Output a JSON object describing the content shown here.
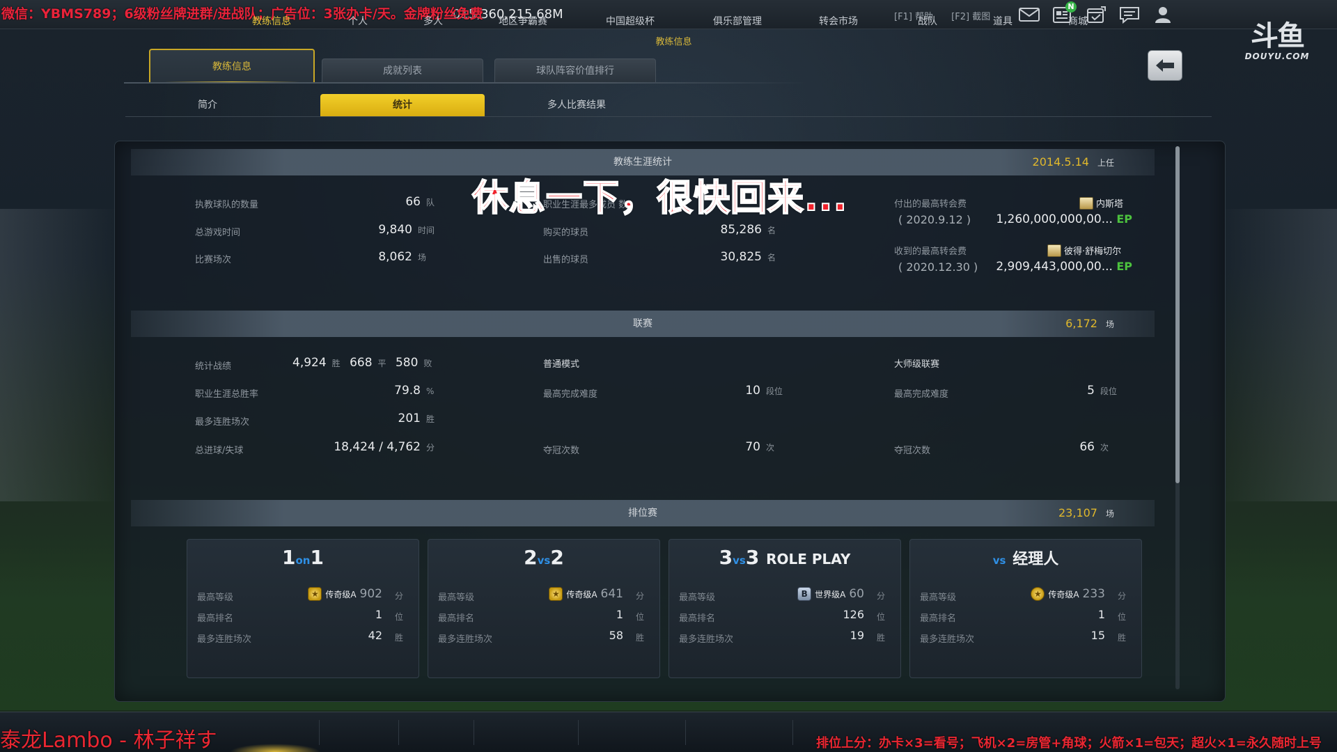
{
  "overlays": {
    "promo_top": "微信：YBMS789；6级粉丝牌进群/进战队；广告位：3张办卡/天。金牌粉丝免费",
    "pause_message": "休息一下，很快回来...",
    "streamer_name": "泰龙Lambo - 林子祥す",
    "promo_bottom": "排位上分：办卡×3=看号；飞机×2=房管+角球；火箭×1=包天；超火×1=永久随时上号"
  },
  "topbar": {
    "currency": "015,360,215.68M",
    "help": "[F1] 帮助",
    "screenshot": "[F2] 截图",
    "notification_badge": "N",
    "logo_glyph": "斗鱼",
    "logo_text": "DOUYU.COM"
  },
  "window_title": "教练信息",
  "main_tabs": [
    {
      "label": "教练信息",
      "active": true
    },
    {
      "label": "成就列表",
      "active": false
    },
    {
      "label": "球队阵容价值排行",
      "active": false
    }
  ],
  "sub_tabs": [
    {
      "label": "简介",
      "active": false
    },
    {
      "label": "统计",
      "active": true
    },
    {
      "label": "多人比赛结果",
      "active": false
    }
  ],
  "career": {
    "title": "教练生涯统计",
    "start_date": "2014.5.14",
    "start_label": "上任",
    "teams_label": "执教球队的数量",
    "teams_value": "66",
    "teams_unit": "队",
    "time_label": "总游戏时间",
    "time_value": "9,840",
    "time_unit": "时间",
    "matches_label": "比赛场次",
    "matches_value": "8,062",
    "matches_unit": "场",
    "partial_label": "职业生涯最多成员 数",
    "bought_label": "购买的球员",
    "bought_value": "85,286",
    "bought_unit": "名",
    "sold_label": "出售的球员",
    "sold_value": "30,825",
    "sold_unit": "名",
    "paid_label": "付出的最高转会费",
    "paid_player": "内斯塔",
    "paid_date": "( 2020.9.12 )",
    "paid_value": "1,260,000,000,00...",
    "paid_currency": "EP",
    "received_label": "收到的最高转会费",
    "received_player": "彼得·舒梅切尔",
    "received_date": "( 2020.12.30 )",
    "received_value": "2,909,443,000,00...",
    "received_currency": "EP"
  },
  "league": {
    "title": "联赛",
    "total": "6,172",
    "total_unit": "场",
    "record_label": "统计战绩",
    "wins": "4,924",
    "wins_unit": "胜",
    "draws": "668",
    "draws_unit": "平",
    "losses": "580",
    "losses_unit": "败",
    "winrate_label": "职业生涯总胜率",
    "winrate_value": "79.8",
    "winrate_unit": "%",
    "streak_label": "最多连胜场次",
    "streak_value": "201",
    "streak_unit": "胜",
    "goals_label": "总进球/失球",
    "goals_value": "18,424 / 4,762",
    "goals_unit": "分",
    "normal_title": "普通模式",
    "normal_diff_label": "最高完成难度",
    "normal_diff_value": "10",
    "normal_diff_unit": "段位",
    "normal_titles_label": "夺冠次数",
    "normal_titles_value": "70",
    "normal_titles_unit": "次",
    "master_title": "大师级联赛",
    "master_diff_label": "最高完成难度",
    "master_diff_value": "5",
    "master_diff_unit": "段位",
    "master_titles_label": "夺冠次数",
    "master_titles_value": "66",
    "master_titles_unit": "次"
  },
  "ranked": {
    "title": "排位赛",
    "total": "23,107",
    "total_unit": "场",
    "row_labels": {
      "grade": "最高等级",
      "rank": "最高排名",
      "streak": "最多连胜场次"
    },
    "units": {
      "points": "分",
      "rank": "位",
      "streak": "胜"
    },
    "cards": [
      {
        "title_a": "1",
        "title_mid": "on",
        "title_b": "1",
        "title_c": "",
        "grade": "传奇级A",
        "points": "902",
        "rank": "1",
        "streak": "42"
      },
      {
        "title_a": "2",
        "title_mid": "vs",
        "title_b": "2",
        "title_c": "",
        "grade": "传奇级A",
        "points": "641",
        "rank": "1",
        "streak": "58"
      },
      {
        "title_a": "3",
        "title_mid": "vs",
        "title_b": "3",
        "title_c": "ROLE PLAY",
        "grade": "世界级A",
        "points": "60",
        "rank": "126",
        "streak": "19"
      },
      {
        "title_a": "",
        "title_mid": "vs",
        "title_b": "",
        "title_c": "经理人",
        "grade": "传奇级A",
        "points": "233",
        "rank": "1",
        "streak": "15"
      }
    ],
    "medal_world_letter": "B"
  },
  "bottom_nav": [
    {
      "label": "教练信息",
      "active": true
    },
    {
      "label": "个人",
      "active": false
    },
    {
      "label": "多人",
      "active": false
    },
    {
      "label": "地区争霸赛",
      "active": false
    },
    {
      "label": "中国超级杯",
      "active": false
    },
    {
      "label": "俱乐部管理",
      "active": false
    },
    {
      "label": "转会市场",
      "active": false
    },
    {
      "label": "战队",
      "active": false
    },
    {
      "label": "道具",
      "active": false
    },
    {
      "label": "商城",
      "active": false
    }
  ],
  "colors": {
    "accent_gold": "#d7b73a",
    "ep_green": "#4cc23e",
    "overlay_red": "#ea2732"
  },
  "icons": [
    "mail-icon",
    "news-icon",
    "calendar-icon",
    "chat-icon",
    "profile-icon",
    "back-arrow-icon",
    "star-medal-icon"
  ]
}
